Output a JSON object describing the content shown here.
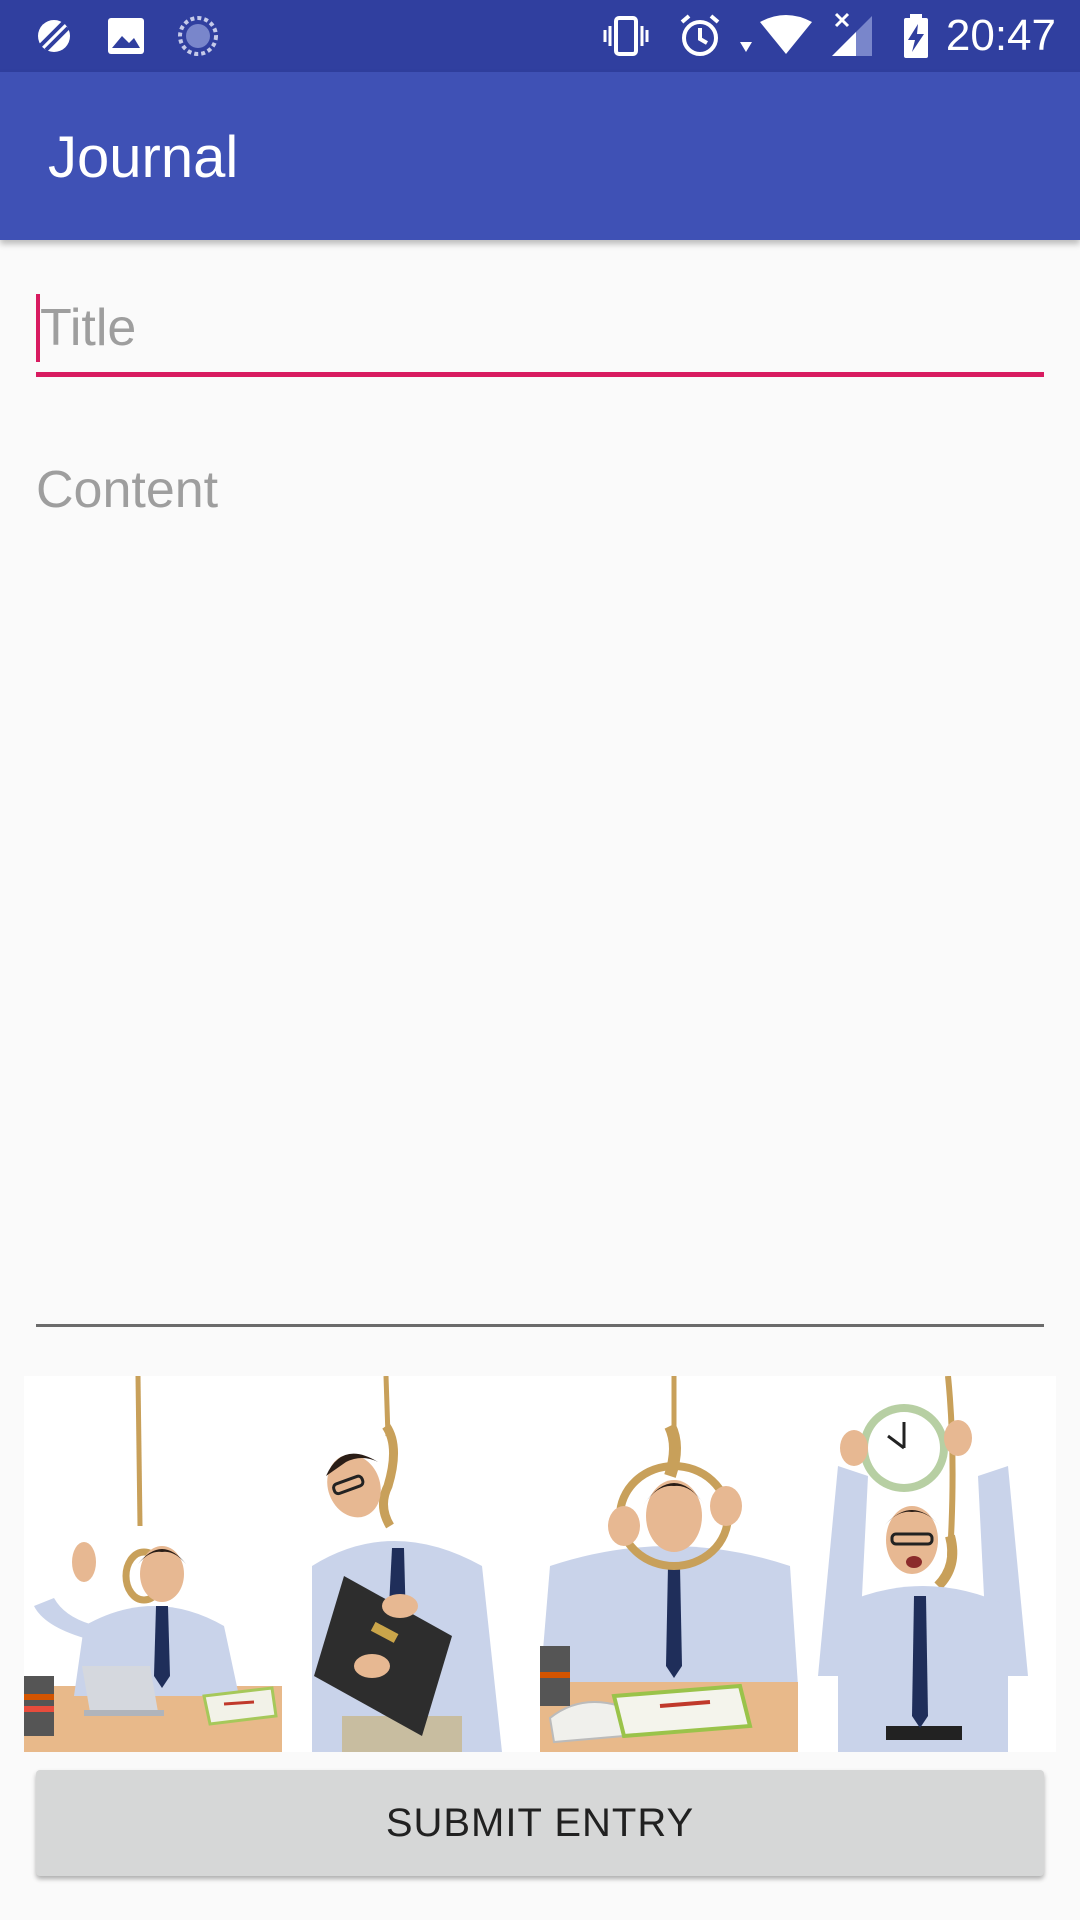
{
  "status_bar": {
    "time": "20:47",
    "left_icons": [
      "no-disturb-icon",
      "image-icon",
      "sync-icon"
    ],
    "right_icons": [
      "vibrate-icon",
      "alarm-icon",
      "wifi-icon",
      "cellular-no-signal-icon",
      "battery-charging-icon"
    ],
    "color": "#303f9f"
  },
  "app_bar": {
    "title": "Journal",
    "color": "#3f51b5"
  },
  "form": {
    "title_placeholder": "Title",
    "title_value": "",
    "content_placeholder": "Content",
    "content_value": "",
    "accent_color": "#d81b60"
  },
  "images": [
    {
      "name": "photo-thumbs-up-at-desk"
    },
    {
      "name": "photo-holding-briefcase"
    },
    {
      "name": "photo-holding-noose"
    },
    {
      "name": "photo-holding-clock"
    }
  ],
  "submit": {
    "label": "SUBMIT ENTRY"
  }
}
